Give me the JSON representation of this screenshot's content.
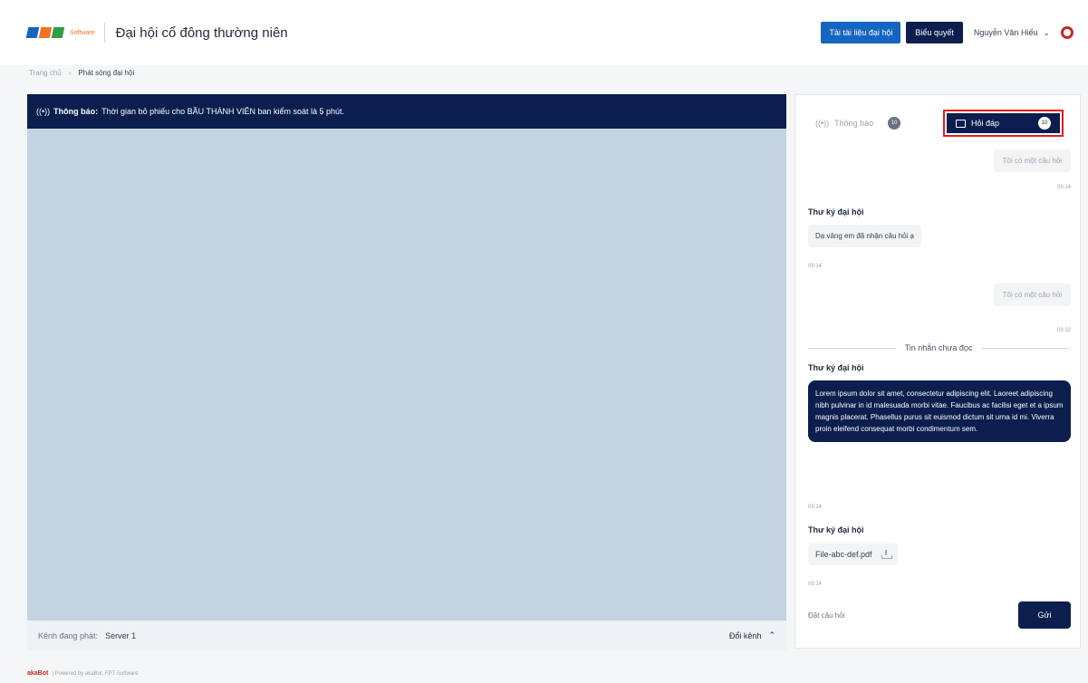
{
  "header": {
    "logo_text": "FPT",
    "logo_sub": "Software",
    "title": "Đại hội cổ đông thường niên",
    "btn_download": "Tải tài liệu đại hội",
    "btn_vote": "Biểu quyết",
    "user_name": "Nguyễn Văn Hiếu",
    "colors": {
      "primary": "#1565c0",
      "dark": "#0b1e4e"
    }
  },
  "breadcrumb": {
    "home": "Trang chủ",
    "separator": "›",
    "current": "Phát sóng đại hội"
  },
  "video": {
    "notice_label": "Thông báo:",
    "notice_text": "Thời gian bỏ phiếu cho BẦU THÀNH VIÊN ban kiểm soát là 5 phút.",
    "channel_label": "Kênh đang phát:",
    "channel_value": "Server 1",
    "switch_label": "Đổi kênh"
  },
  "side": {
    "tab_notice_label": "Thông báo",
    "tab_notice_count": "10",
    "tab_qa_label": "Hỏi đáp",
    "tab_qa_count": "10",
    "msg1": "Tôi có một câu hỏi",
    "msg1_time": "09:14",
    "sender1": "Thư ký đại hội",
    "reply1": "Dạ vâng em đã nhận câu hỏi ạ",
    "reply1_time": "09:14",
    "msg2": "Tôi có một câu hỏi",
    "msg2_time": "09:32",
    "unread_label": "Tin nhắn chưa đọc",
    "sender2": "Thư ký đại hội",
    "long_msg": "Lorem ipsum dolor sit amet, consectetur adipiscing elit. Laoreet adipiscing nibh pulvinar in id malesuada morbi vitae. Faucibus ac facilisi eget et a ipsum magnis placerat. Phasellus purus sit euismod dictum sit urna id mi. Viverra proin eleifend consequat morbi condimentum sem.",
    "long_msg_time": "09:14",
    "sender3": "Thư ký đại hội",
    "file_name": "File-abc-def.pdf",
    "file_time": "09:14",
    "input_placeholder": "Đặt câu hỏi",
    "send_label": "Gửi"
  },
  "footer": {
    "brand": "akaBot",
    "text": "| Powered by akaBot, FPT Software"
  }
}
